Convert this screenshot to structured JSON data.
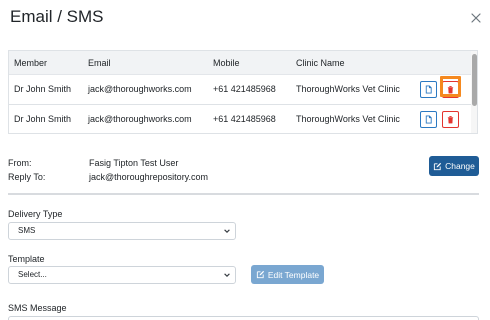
{
  "modal": {
    "title": "Email / SMS"
  },
  "colors": {
    "primary": "#1f5c96",
    "danger": "#e3342f",
    "highlight": "#f5891f",
    "disabled_primary": "#7aa7d1"
  },
  "icons": {
    "close": "close-icon",
    "document": "document-icon",
    "delete": "trash-icon",
    "edit": "edit-icon",
    "dropdown": "chevron-down-icon"
  },
  "table": {
    "headers": [
      "Member",
      "Email",
      "Mobile",
      "Clinic Name"
    ],
    "rows": [
      {
        "member": "Dr John Smith",
        "email": "jack@thoroughworks.com",
        "mobile": "+61 421485968",
        "clinic": "ThoroughWorks Vet Clinic"
      },
      {
        "member": "Dr John Smith",
        "email": "jack@thoroughworks.com",
        "mobile": "+61 421485968",
        "clinic": "ThoroughWorks Vet Clinic"
      }
    ]
  },
  "sender": {
    "from_label": "From:",
    "from_value": "Fasig Tipton Test User",
    "reply_label": "Reply To:",
    "reply_value": "jack@thoroughrepository.com",
    "change_label": "Change"
  },
  "delivery": {
    "label": "Delivery Type",
    "selected": "SMS"
  },
  "template": {
    "label": "Template",
    "selected": "Select...",
    "edit_label": "Edit Template"
  },
  "sms": {
    "label": "SMS Message"
  }
}
